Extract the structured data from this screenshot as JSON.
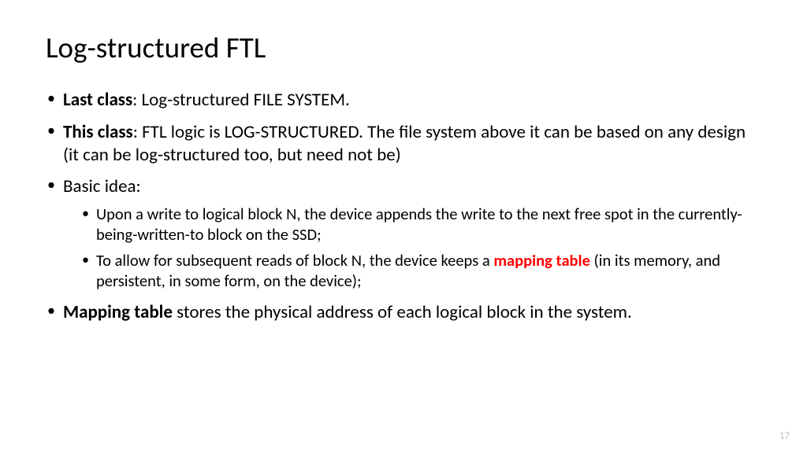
{
  "title": "Log-structured FTL",
  "bullets": {
    "b1_bold": "Last class",
    "b1_rest": ": Log-structured FILE SYSTEM.",
    "b2_bold": "This class",
    "b2_rest": ": FTL logic is LOG-STRUCTURED. The file system above it can be based on any design (it can be log-structured too, but need not be)",
    "b3": "Basic idea:",
    "b3_sub1": "Upon a write to logical block N, the device appends the write to the next free spot in the currently-being-written-to block on the SSD;",
    "b3_sub2_pre": "To allow for subsequent reads of block N, the device keeps a ",
    "b3_sub2_red": "mapping table",
    "b3_sub2_post": " (in its memory, and persistent, in some form, on the device);",
    "b4_bold": "Mapping table",
    "b4_rest": " stores the physical address of each logical block in the system."
  },
  "page_number": "17"
}
